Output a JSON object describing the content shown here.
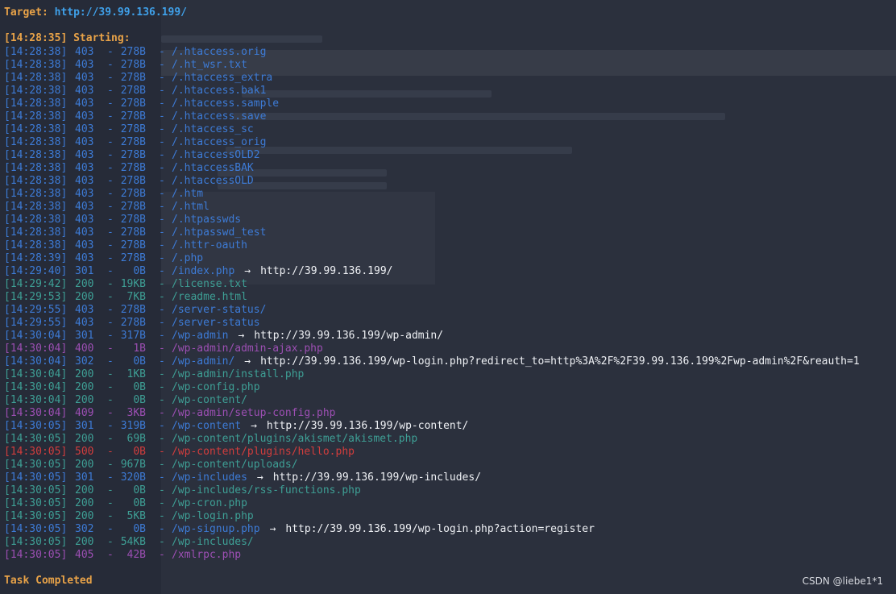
{
  "target": {
    "label": "Target:",
    "url": "http://39.99.136.199/"
  },
  "start": {
    "label": "[14:28:35] Starting:"
  },
  "results": [
    {
      "time": "[14:28:38]",
      "status": "403",
      "size": "278B",
      "path": "/.htaccess.orig",
      "redirect": "",
      "tone": "blue"
    },
    {
      "time": "[14:28:38]",
      "status": "403",
      "size": "278B",
      "path": "/.ht_wsr.txt",
      "redirect": "",
      "tone": "blue"
    },
    {
      "time": "[14:28:38]",
      "status": "403",
      "size": "278B",
      "path": "/.htaccess_extra",
      "redirect": "",
      "tone": "blue"
    },
    {
      "time": "[14:28:38]",
      "status": "403",
      "size": "278B",
      "path": "/.htaccess.bak1",
      "redirect": "",
      "tone": "blue"
    },
    {
      "time": "[14:28:38]",
      "status": "403",
      "size": "278B",
      "path": "/.htaccess.sample",
      "redirect": "",
      "tone": "blue"
    },
    {
      "time": "[14:28:38]",
      "status": "403",
      "size": "278B",
      "path": "/.htaccess.save",
      "redirect": "",
      "tone": "blue"
    },
    {
      "time": "[14:28:38]",
      "status": "403",
      "size": "278B",
      "path": "/.htaccess_sc",
      "redirect": "",
      "tone": "blue"
    },
    {
      "time": "[14:28:38]",
      "status": "403",
      "size": "278B",
      "path": "/.htaccess_orig",
      "redirect": "",
      "tone": "blue"
    },
    {
      "time": "[14:28:38]",
      "status": "403",
      "size": "278B",
      "path": "/.htaccessOLD2",
      "redirect": "",
      "tone": "blue"
    },
    {
      "time": "[14:28:38]",
      "status": "403",
      "size": "278B",
      "path": "/.htaccessBAK",
      "redirect": "",
      "tone": "blue"
    },
    {
      "time": "[14:28:38]",
      "status": "403",
      "size": "278B",
      "path": "/.htaccessOLD",
      "redirect": "",
      "tone": "blue"
    },
    {
      "time": "[14:28:38]",
      "status": "403",
      "size": "278B",
      "path": "/.htm",
      "redirect": "",
      "tone": "blue"
    },
    {
      "time": "[14:28:38]",
      "status": "403",
      "size": "278B",
      "path": "/.html",
      "redirect": "",
      "tone": "blue"
    },
    {
      "time": "[14:28:38]",
      "status": "403",
      "size": "278B",
      "path": "/.htpasswds",
      "redirect": "",
      "tone": "blue"
    },
    {
      "time": "[14:28:38]",
      "status": "403",
      "size": "278B",
      "path": "/.htpasswd_test",
      "redirect": "",
      "tone": "blue"
    },
    {
      "time": "[14:28:38]",
      "status": "403",
      "size": "278B",
      "path": "/.httr-oauth",
      "redirect": "",
      "tone": "blue"
    },
    {
      "time": "[14:28:39]",
      "status": "403",
      "size": "278B",
      "path": "/.php",
      "redirect": "",
      "tone": "blue"
    },
    {
      "time": "[14:29:40]",
      "status": "301",
      "size": "0B",
      "path": "/index.php",
      "redirect": "http://39.99.136.199/",
      "tone": "blue"
    },
    {
      "time": "[14:29:42]",
      "status": "200",
      "size": "19KB",
      "path": "/license.txt",
      "redirect": "",
      "tone": "teal"
    },
    {
      "time": "[14:29:53]",
      "status": "200",
      "size": "7KB",
      "path": "/readme.html",
      "redirect": "",
      "tone": "teal"
    },
    {
      "time": "[14:29:55]",
      "status": "403",
      "size": "278B",
      "path": "/server-status/",
      "redirect": "",
      "tone": "blue"
    },
    {
      "time": "[14:29:55]",
      "status": "403",
      "size": "278B",
      "path": "/server-status",
      "redirect": "",
      "tone": "blue"
    },
    {
      "time": "[14:30:04]",
      "status": "301",
      "size": "317B",
      "path": "/wp-admin",
      "redirect": "http://39.99.136.199/wp-admin/",
      "tone": "blue"
    },
    {
      "time": "[14:30:04]",
      "status": "400",
      "size": "1B",
      "path": "/wp-admin/admin-ajax.php",
      "redirect": "",
      "tone": "purple"
    },
    {
      "time": "[14:30:04]",
      "status": "302",
      "size": "0B",
      "path": "/wp-admin/",
      "redirect": "http://39.99.136.199/wp-login.php?redirect_to=http%3A%2F%2F39.99.136.199%2Fwp-admin%2F&reauth=1",
      "tone": "blue"
    },
    {
      "time": "[14:30:04]",
      "status": "200",
      "size": "1KB",
      "path": "/wp-admin/install.php",
      "redirect": "",
      "tone": "teal"
    },
    {
      "time": "[14:30:04]",
      "status": "200",
      "size": "0B",
      "path": "/wp-config.php",
      "redirect": "",
      "tone": "teal"
    },
    {
      "time": "[14:30:04]",
      "status": "200",
      "size": "0B",
      "path": "/wp-content/",
      "redirect": "",
      "tone": "teal"
    },
    {
      "time": "[14:30:04]",
      "status": "409",
      "size": "3KB",
      "path": "/wp-admin/setup-config.php",
      "redirect": "",
      "tone": "purple"
    },
    {
      "time": "[14:30:05]",
      "status": "301",
      "size": "319B",
      "path": "/wp-content",
      "redirect": "http://39.99.136.199/wp-content/",
      "tone": "blue"
    },
    {
      "time": "[14:30:05]",
      "status": "200",
      "size": "69B",
      "path": "/wp-content/plugins/akismet/akismet.php",
      "redirect": "",
      "tone": "teal"
    },
    {
      "time": "[14:30:05]",
      "status": "500",
      "size": "0B",
      "path": "/wp-content/plugins/hello.php",
      "redirect": "",
      "tone": "red"
    },
    {
      "time": "[14:30:05]",
      "status": "200",
      "size": "967B",
      "path": "/wp-content/uploads/",
      "redirect": "",
      "tone": "teal"
    },
    {
      "time": "[14:30:05]",
      "status": "301",
      "size": "320B",
      "path": "/wp-includes",
      "redirect": "http://39.99.136.199/wp-includes/",
      "tone": "blue"
    },
    {
      "time": "[14:30:05]",
      "status": "200",
      "size": "0B",
      "path": "/wp-includes/rss-functions.php",
      "redirect": "",
      "tone": "teal"
    },
    {
      "time": "[14:30:05]",
      "status": "200",
      "size": "0B",
      "path": "/wp-cron.php",
      "redirect": "",
      "tone": "teal"
    },
    {
      "time": "[14:30:05]",
      "status": "200",
      "size": "5KB",
      "path": "/wp-login.php",
      "redirect": "",
      "tone": "teal"
    },
    {
      "time": "[14:30:05]",
      "status": "302",
      "size": "0B",
      "path": "/wp-signup.php",
      "redirect": "http://39.99.136.199/wp-login.php?action=register",
      "tone": "blue"
    },
    {
      "time": "[14:30:05]",
      "status": "200",
      "size": "54KB",
      "path": "/wp-includes/",
      "redirect": "",
      "tone": "teal"
    },
    {
      "time": "[14:30:05]",
      "status": "405",
      "size": "42B",
      "path": "/xmlrpc.php",
      "redirect": "",
      "tone": "purple"
    }
  ],
  "separator": "-",
  "arrow": "→",
  "footer": {
    "completed": "Task Completed"
  },
  "watermark": "CSDN @liebe1*1",
  "colors": {
    "background": "#262b38",
    "label": "#e9a348",
    "url": "#3fa0e9",
    "blue": "#3d7bd6",
    "teal": "#3e9f95",
    "purple": "#9c4fb3",
    "red": "#d23d3d"
  }
}
